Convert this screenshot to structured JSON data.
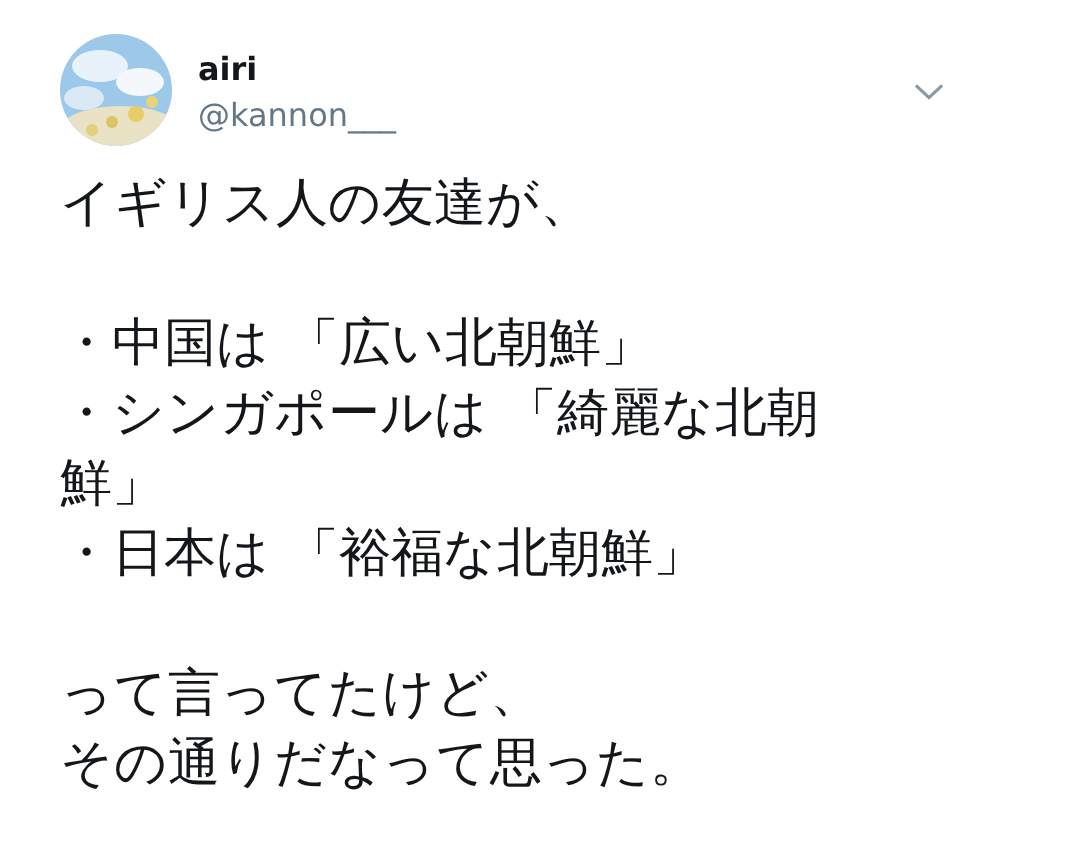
{
  "tweet": {
    "author_name": "airi",
    "handle": "@kannon___",
    "paragraphs": [
      [
        "イギリス人の友達が、"
      ],
      [
        "・中国は 「広い北朝鮮」",
        "・シンガポールは 「綺麗な北朝鮮」",
        "・日本は 「裕福な北朝鮮」"
      ],
      [
        "って言ってたけど、",
        "その通りだなって思った。"
      ]
    ]
  }
}
